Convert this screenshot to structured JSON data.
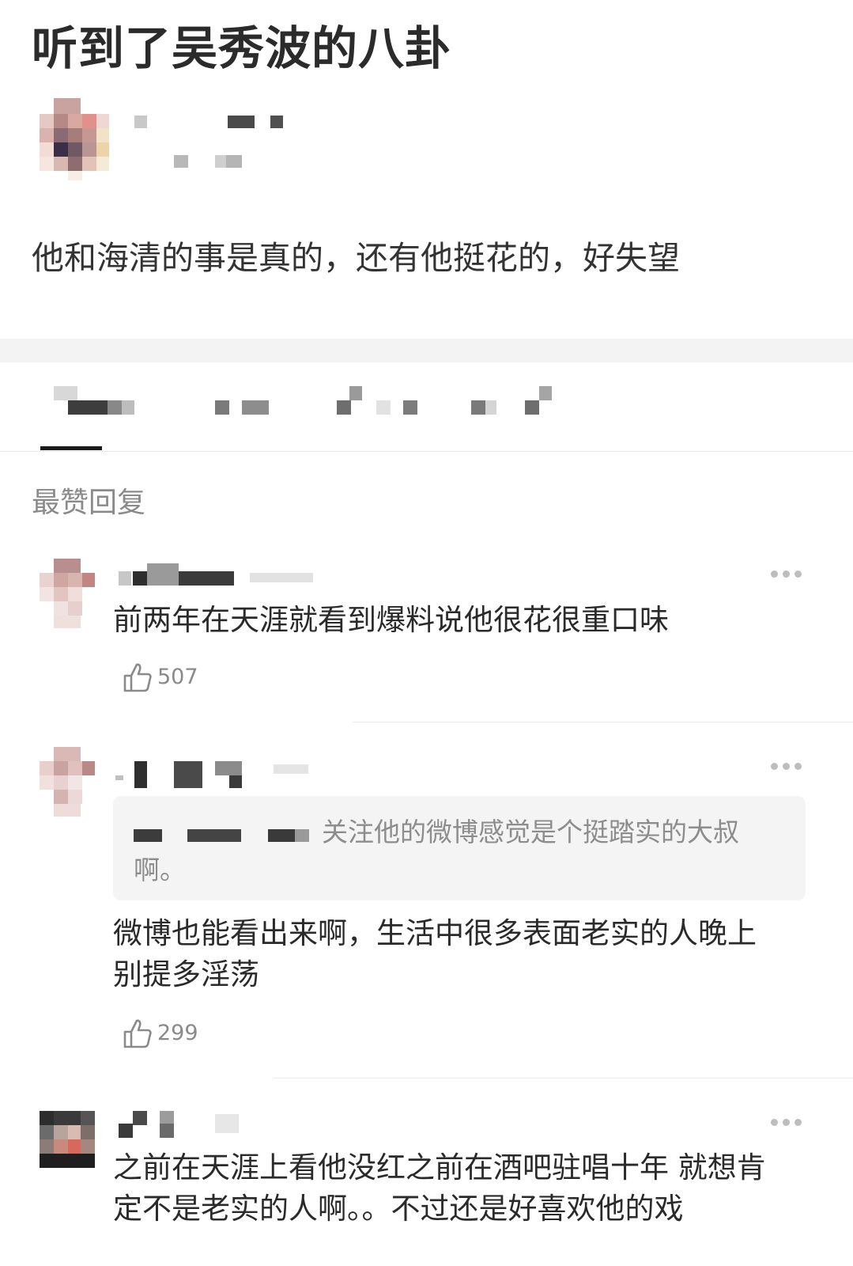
{
  "post": {
    "title": "听到了吴秀波的八卦",
    "body": "他和海清的事是真的，还有他挺花的，好失望"
  },
  "section_label": "最赞回复",
  "comments": [
    {
      "text_lines": [
        "前两年在天涯就看到爆料说他很花很重口味"
      ],
      "likes": "507"
    },
    {
      "quote_lines": [
        "关注他的微博感觉是个挺踏实的大叔",
        "啊。"
      ],
      "text_lines": [
        "微博也能看出来啊，生活中很多表面老实的人晚上",
        "别提多淫荡"
      ],
      "likes": "299"
    },
    {
      "text_lines": [
        "之前在天涯上看他没红之前在酒吧驻唱十年 就想肯",
        "定不是老实的人啊。。不过还是好喜欢他的戏"
      ]
    }
  ],
  "icons": {
    "like": "thumbs-up-icon",
    "more": "more-dots-icon"
  },
  "colors": {
    "text": "#2a2a2a",
    "muted": "#8a8a8a",
    "quote_bg": "#f4f4f5",
    "divider": "#f3f3f3",
    "active_tab": "#1a1a1a"
  }
}
